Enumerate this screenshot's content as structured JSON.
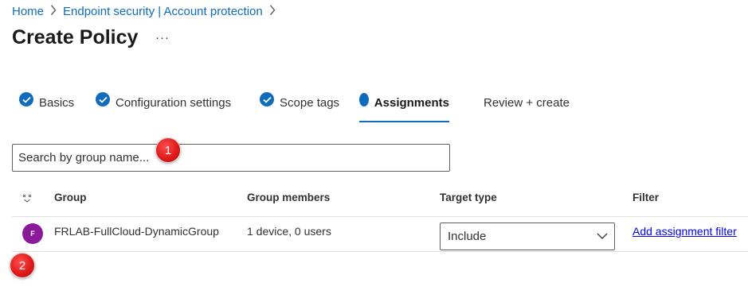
{
  "breadcrumb": {
    "home": "Home",
    "section": "Endpoint security | Account protection",
    "separator_icon": "chevron-right-icon"
  },
  "header": {
    "title": "Create Policy",
    "more": "···"
  },
  "wizard": {
    "tabs": [
      {
        "label": "Basics",
        "state": "completed",
        "icon": "check-circle-icon"
      },
      {
        "label": "Configuration settings",
        "state": "completed",
        "icon": "check-circle-icon"
      },
      {
        "label": "Scope tags",
        "state": "completed",
        "icon": "check-circle-icon"
      },
      {
        "label": "Assignments",
        "state": "active",
        "icon": "filled-circle-icon"
      },
      {
        "label": "Review + create",
        "state": "pending",
        "icon": ""
      }
    ]
  },
  "search": {
    "placeholder": "Search by group name...",
    "value": ""
  },
  "callouts": [
    "1",
    "2"
  ],
  "table": {
    "columns": [
      "Group",
      "Group members",
      "Target type",
      "Filter"
    ],
    "rows": [
      {
        "avatar": "F",
        "group": "FRLAB-FullCloud-DynamicGroup",
        "members": "1 device, 0 users",
        "target_type": "Include",
        "filter_link": "Add assignment filter"
      }
    ]
  },
  "colors": {
    "accent": "#0f6cbd",
    "avatar": "#8b1a9b",
    "callout": "#e01b1b",
    "link": "#0000ee"
  }
}
